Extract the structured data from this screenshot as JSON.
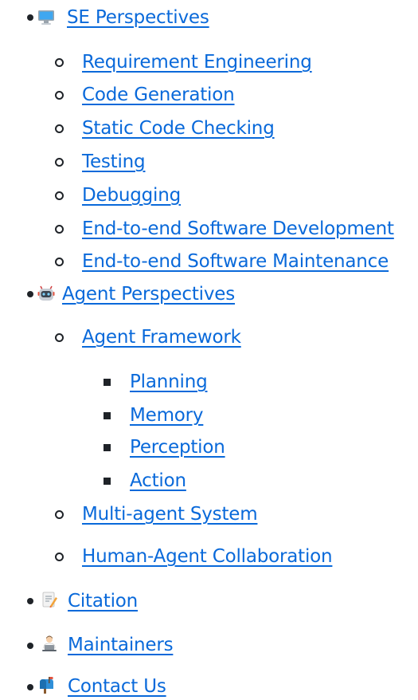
{
  "toc": {
    "se": {
      "label": "SE Perspectives",
      "icon": "desktop-computer-icon",
      "children": [
        "Requirement Engineering",
        "Code Generation",
        "Static Code Checking",
        "Testing",
        "Debugging",
        "End-to-end Software Development",
        "End-to-end Software Maintenance"
      ]
    },
    "agent": {
      "label": "Agent Perspectives",
      "icon": "robot-icon",
      "framework": {
        "label": "Agent Framework",
        "children": [
          "Planning",
          "Memory",
          "Perception",
          "Action"
        ]
      },
      "multi": "Multi-agent System",
      "human": "Human-Agent Collaboration"
    },
    "citation": {
      "label": "Citation",
      "icon": "memo-icon"
    },
    "maintainers": {
      "label": "Maintainers",
      "icon": "technologist-icon"
    },
    "contact": {
      "label": "Contact Us",
      "icon": "mailbox-icon"
    }
  },
  "colors": {
    "link": "#0969da",
    "text": "#1f2328"
  }
}
